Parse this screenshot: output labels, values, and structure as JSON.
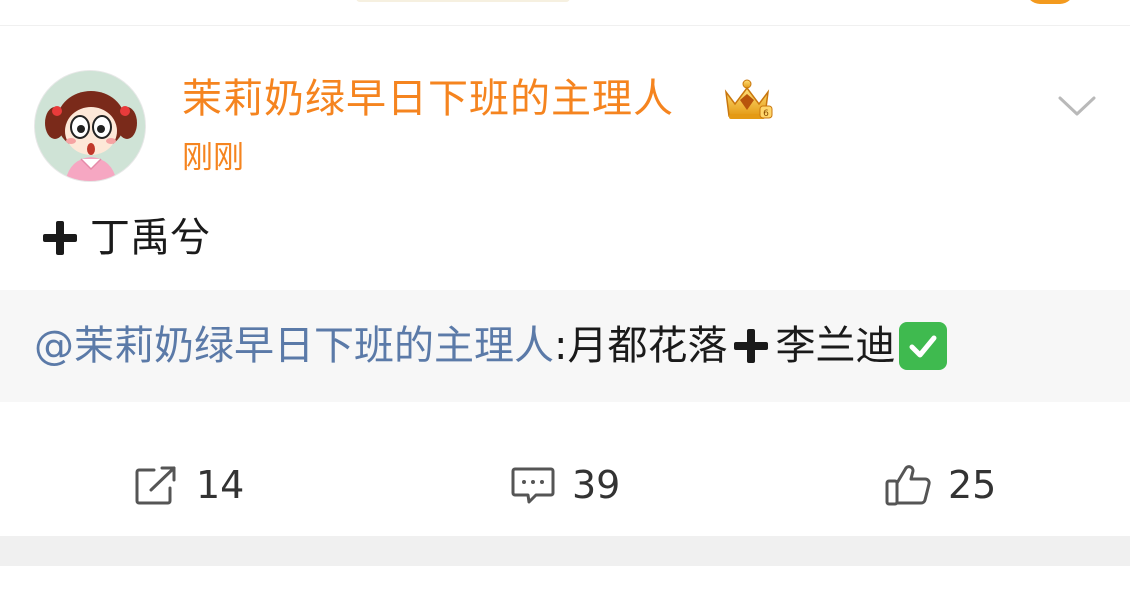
{
  "post": {
    "username": "茉莉奶绿早日下班的主理人",
    "badge_icon": "crown-badge-icon",
    "time": "刚刚",
    "text": "丁禹兮",
    "text_icon": "heavy-plus-icon"
  },
  "quote": {
    "mention": "@茉莉奶绿早日下班的主理人",
    "separator": " :",
    "text_before": "月都花落",
    "text_after": "李兰迪",
    "trailing_icon": "check-mark-button-icon"
  },
  "actions": {
    "share_count": "14",
    "comment_count": "39",
    "like_count": "25"
  },
  "colors": {
    "username": "#f5841f",
    "mention": "#5b7aa8",
    "check": "#3fba4f",
    "quote_bg": "#f7f7f7"
  }
}
